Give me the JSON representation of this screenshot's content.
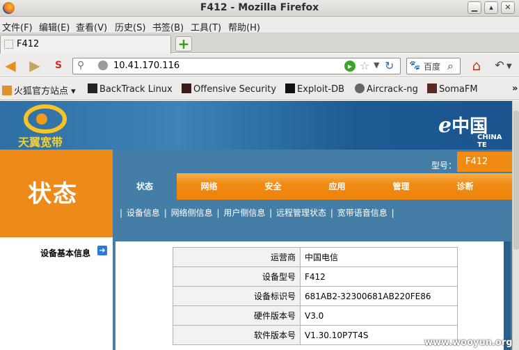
{
  "window": {
    "title": "F412 - Mozilla Firefox"
  },
  "menu": [
    "文件(F)",
    "编辑(E)",
    "查看(V)",
    "历史(S)",
    "书签(B)",
    "工具(T)",
    "帮助(H)"
  ],
  "tab": {
    "title": "F412"
  },
  "navbar": {
    "url": "10.41.170.116",
    "search_text": "百度"
  },
  "bookmarks": [
    {
      "label": "火狐官方站点 ▾",
      "icon": "folder-icon"
    },
    {
      "label": "BackTrack Linux",
      "icon": "backtrack-icon"
    },
    {
      "label": "Offensive Security",
      "icon": "offsec-icon"
    },
    {
      "label": "Exploit-DB",
      "icon": "exploitdb-icon"
    },
    {
      "label": "Aircrack-ng",
      "icon": "aircrack-icon"
    },
    {
      "label": "SomaFM",
      "icon": "somafm-icon"
    }
  ],
  "bookmarks_more": "»",
  "router": {
    "brand": "天翼宽带",
    "operator_logo": "中国",
    "operator_sub": "CHINA TE",
    "section_title": "状态",
    "model_label": "型号：",
    "model_value": "F412",
    "tabs": [
      "状态",
      "网络",
      "安全",
      "应用",
      "管理",
      "诊断"
    ],
    "subnav": [
      "设备信息",
      "网络侧信息",
      "用户侧信息",
      "远程管理状态",
      "宽带语音信息"
    ],
    "sidebar_link": "设备基本信息",
    "info_rows": [
      {
        "label": "运营商",
        "value": "中国电信"
      },
      {
        "label": "设备型号",
        "value": "F412"
      },
      {
        "label": "设备标识号",
        "value": "681AB2-32300681AB220FE86"
      },
      {
        "label": "硬件版本号",
        "value": "V3.0"
      },
      {
        "label": "软件版本号",
        "value": "V1.30.10P7T4S"
      }
    ]
  },
  "watermark": "www.wooyun.org",
  "colors": {
    "orange": "#ee8a1a",
    "blue": "#447ea7"
  }
}
